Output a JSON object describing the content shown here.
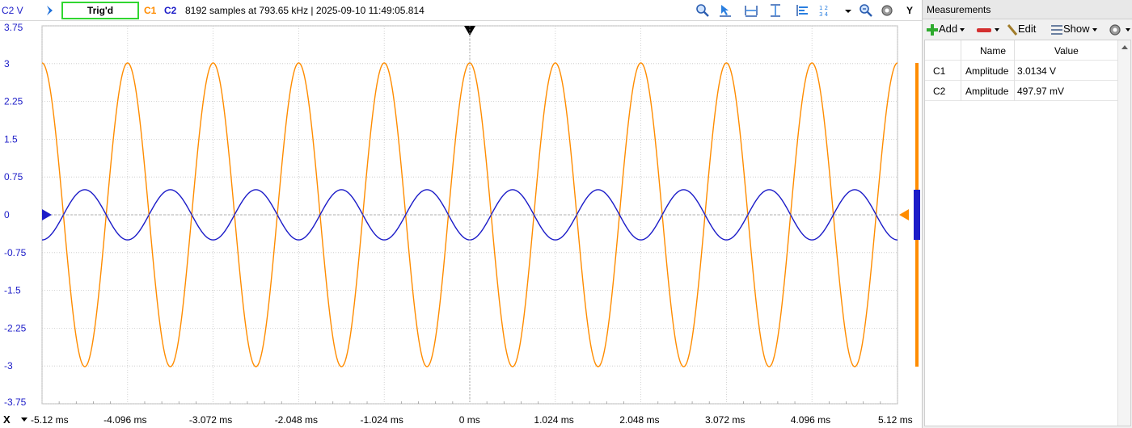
{
  "toolbar": {
    "y_unit_label": "C2 V",
    "trigger_status": "Trig'd",
    "channel1_label": "C1",
    "channel2_label": "C2",
    "acquisition_info": "8192 samples at 793.65 kHz  | 2025-09-10 11:49:05.814",
    "y_button": "Y"
  },
  "axis_bar": {
    "x_button": "X"
  },
  "colors": {
    "channel1": "#ff8c00",
    "channel2": "#1c1cc8",
    "trigger_ok": "#31d631",
    "grid": "#c8c8c8"
  },
  "chart_data": {
    "type": "line",
    "y_ticks": [
      "3.75",
      "3",
      "2.25",
      "1.5",
      "0.75",
      "0",
      "-0.75",
      "-1.5",
      "-2.25",
      "-3",
      "-3.75"
    ],
    "x_ticks": [
      "-5.12 ms",
      "-4.096 ms",
      "-3.072 ms",
      "-2.048 ms",
      "-1.024 ms",
      "0 ms",
      "1.024 ms",
      "2.048 ms",
      "3.072 ms",
      "4.096 ms",
      "5.12 ms"
    ],
    "xlim_ms": [
      -5.12,
      5.12
    ],
    "ylim": [
      -3.75,
      3.75
    ],
    "grid": true,
    "series": [
      {
        "name": "C1",
        "color": "#ff8c00",
        "amplitude": 3.0134,
        "period_ms": 1.024,
        "phase": "cosine",
        "offset": 0
      },
      {
        "name": "C2",
        "color": "#1c1cc8",
        "amplitude": 0.498,
        "period_ms": 1.024,
        "phase": "negative-cosine",
        "offset": 0
      }
    ]
  },
  "panel": {
    "title": "Measurements",
    "add_label": "Add",
    "edit_label": "Edit",
    "show_label": "Show",
    "columns": [
      "",
      "Name",
      "Value"
    ],
    "rows": [
      {
        "channel": "C1",
        "name": "Amplitude",
        "value": "3.0134 V"
      },
      {
        "channel": "C2",
        "name": "Amplitude",
        "value": "497.97 mV"
      }
    ]
  }
}
